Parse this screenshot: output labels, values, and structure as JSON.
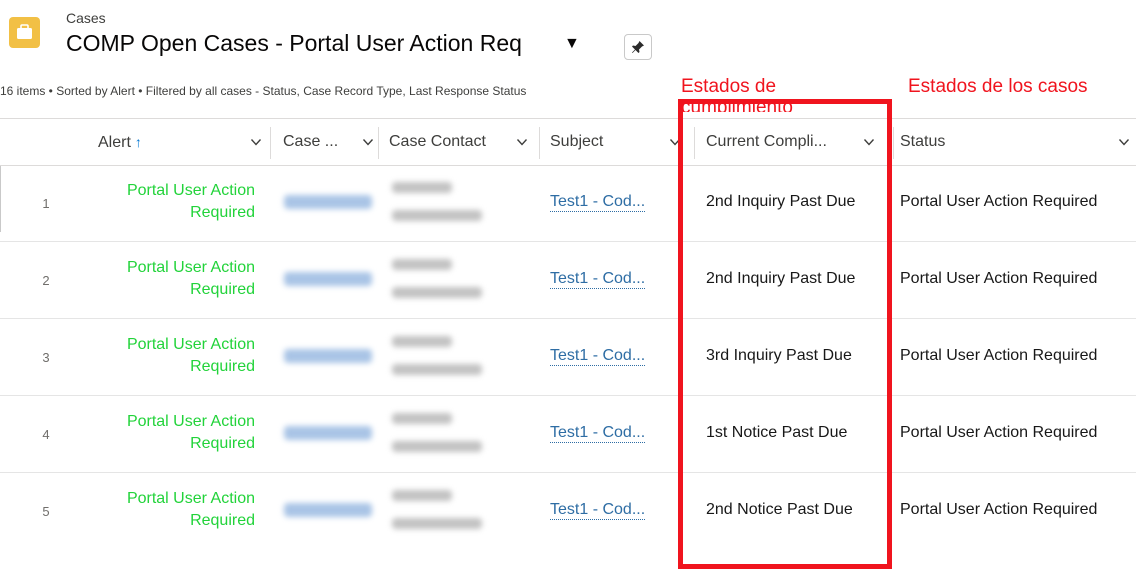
{
  "header": {
    "breadcrumb": "Cases",
    "title": "COMP Open Cases - Portal User Action Req",
    "title_caret": "▼",
    "icon": "briefcase-icon",
    "pin_icon": "pin-icon",
    "meta": "16 items • Sorted by Alert • Filtered by all cases - Status, Case Record Type, Last Response Status"
  },
  "annotations": {
    "left": "Estados de cumplimiento",
    "right": "Estados de los casos",
    "color": "#f0141e"
  },
  "columns": [
    {
      "label": "Alert",
      "sort": "↑"
    },
    {
      "label": "Case ..."
    },
    {
      "label": "Case Contact"
    },
    {
      "label": "Subject"
    },
    {
      "label": "Current Compli..."
    },
    {
      "label": "Status"
    }
  ],
  "rows": [
    {
      "num": "1",
      "alert": "Portal User Action Required",
      "subject": "Test1 - Cod...",
      "compliance": "2nd Inquiry Past Due",
      "status": "Portal User Action Required"
    },
    {
      "num": "2",
      "alert": "Portal User Action Required",
      "subject": "Test1 - Cod...",
      "compliance": "2nd Inquiry Past Due",
      "status": "Portal User Action Required"
    },
    {
      "num": "3",
      "alert": "Portal User Action Required",
      "subject": "Test1 - Cod...",
      "compliance": "3rd Inquiry Past Due",
      "status": "Portal User Action Required"
    },
    {
      "num": "4",
      "alert": "Portal User Action Required",
      "subject": "Test1 - Cod...",
      "compliance": "1st Notice Past Due",
      "status": "Portal User Action Required"
    },
    {
      "num": "5",
      "alert": "Portal User Action Required",
      "subject": "Test1 - Cod...",
      "compliance": "2nd Notice Past Due",
      "status": "Portal User Action Required"
    }
  ],
  "colors": {
    "alert_green": "#22d33a",
    "link_blue": "#2e6da4",
    "object_icon": "#f2c045"
  }
}
